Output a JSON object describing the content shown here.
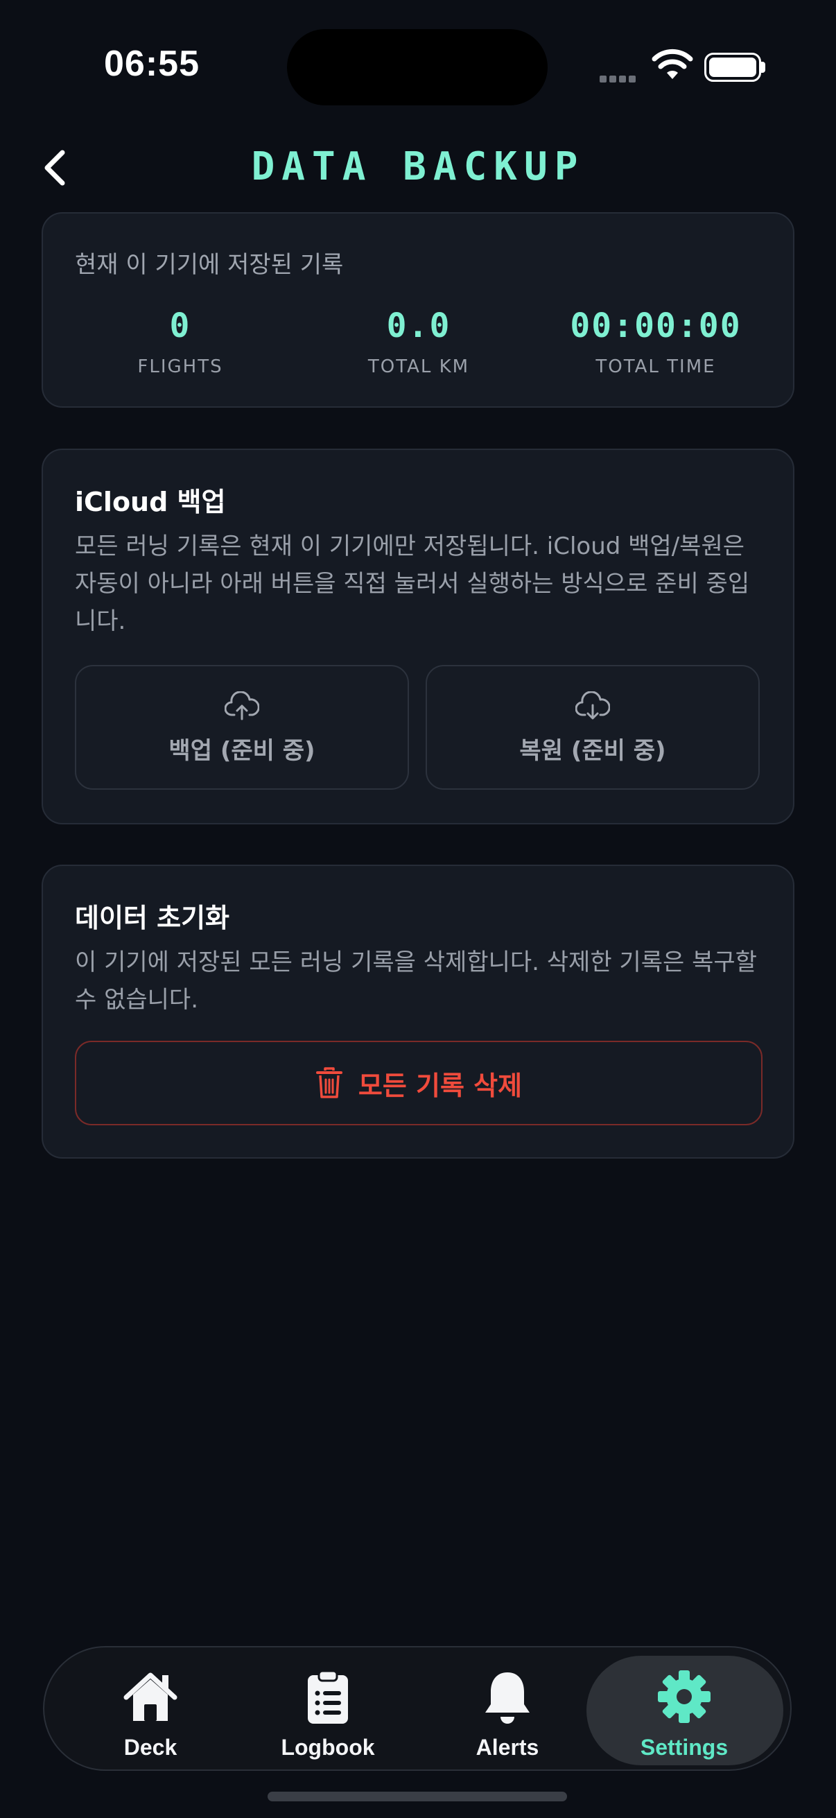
{
  "status_bar": {
    "time": "06:55"
  },
  "header": {
    "title": "DATA BACKUP"
  },
  "storage": {
    "label": "현재 이 기기에 저장된 기록",
    "stats": [
      {
        "value": "0",
        "label": "FLIGHTS"
      },
      {
        "value": "0.0",
        "label": "TOTAL KM"
      },
      {
        "value": "00:00:00",
        "label": "TOTAL TIME"
      }
    ]
  },
  "icloud": {
    "title": "iCloud 백업",
    "description": "모든 러닝 기록은 현재 이 기기에만 저장됩니다. iCloud 백업/복원은 자동이 아니라 아래 버튼을 직접 눌러서 실행하는 방식으로 준비 중입니다.",
    "backup_label": "백업 (준비 중)",
    "restore_label": "복원 (준비 중)"
  },
  "reset": {
    "title": "데이터 초기화",
    "description": "이 기기에 저장된 모든 러닝 기록을 삭제합니다. 삭제한 기록은 복구할 수 없습니다.",
    "delete_label": "모든 기록 삭제"
  },
  "tabs": [
    {
      "label": "Deck",
      "icon": "house-icon"
    },
    {
      "label": "Logbook",
      "icon": "clipboard-list-icon"
    },
    {
      "label": "Alerts",
      "icon": "bell-icon"
    },
    {
      "label": "Settings",
      "icon": "gear-icon",
      "active": true
    }
  ],
  "colors": {
    "accent": "#7ff0d2",
    "danger": "#f04b3c",
    "background": "#0b0e15",
    "card": "#151a23"
  }
}
